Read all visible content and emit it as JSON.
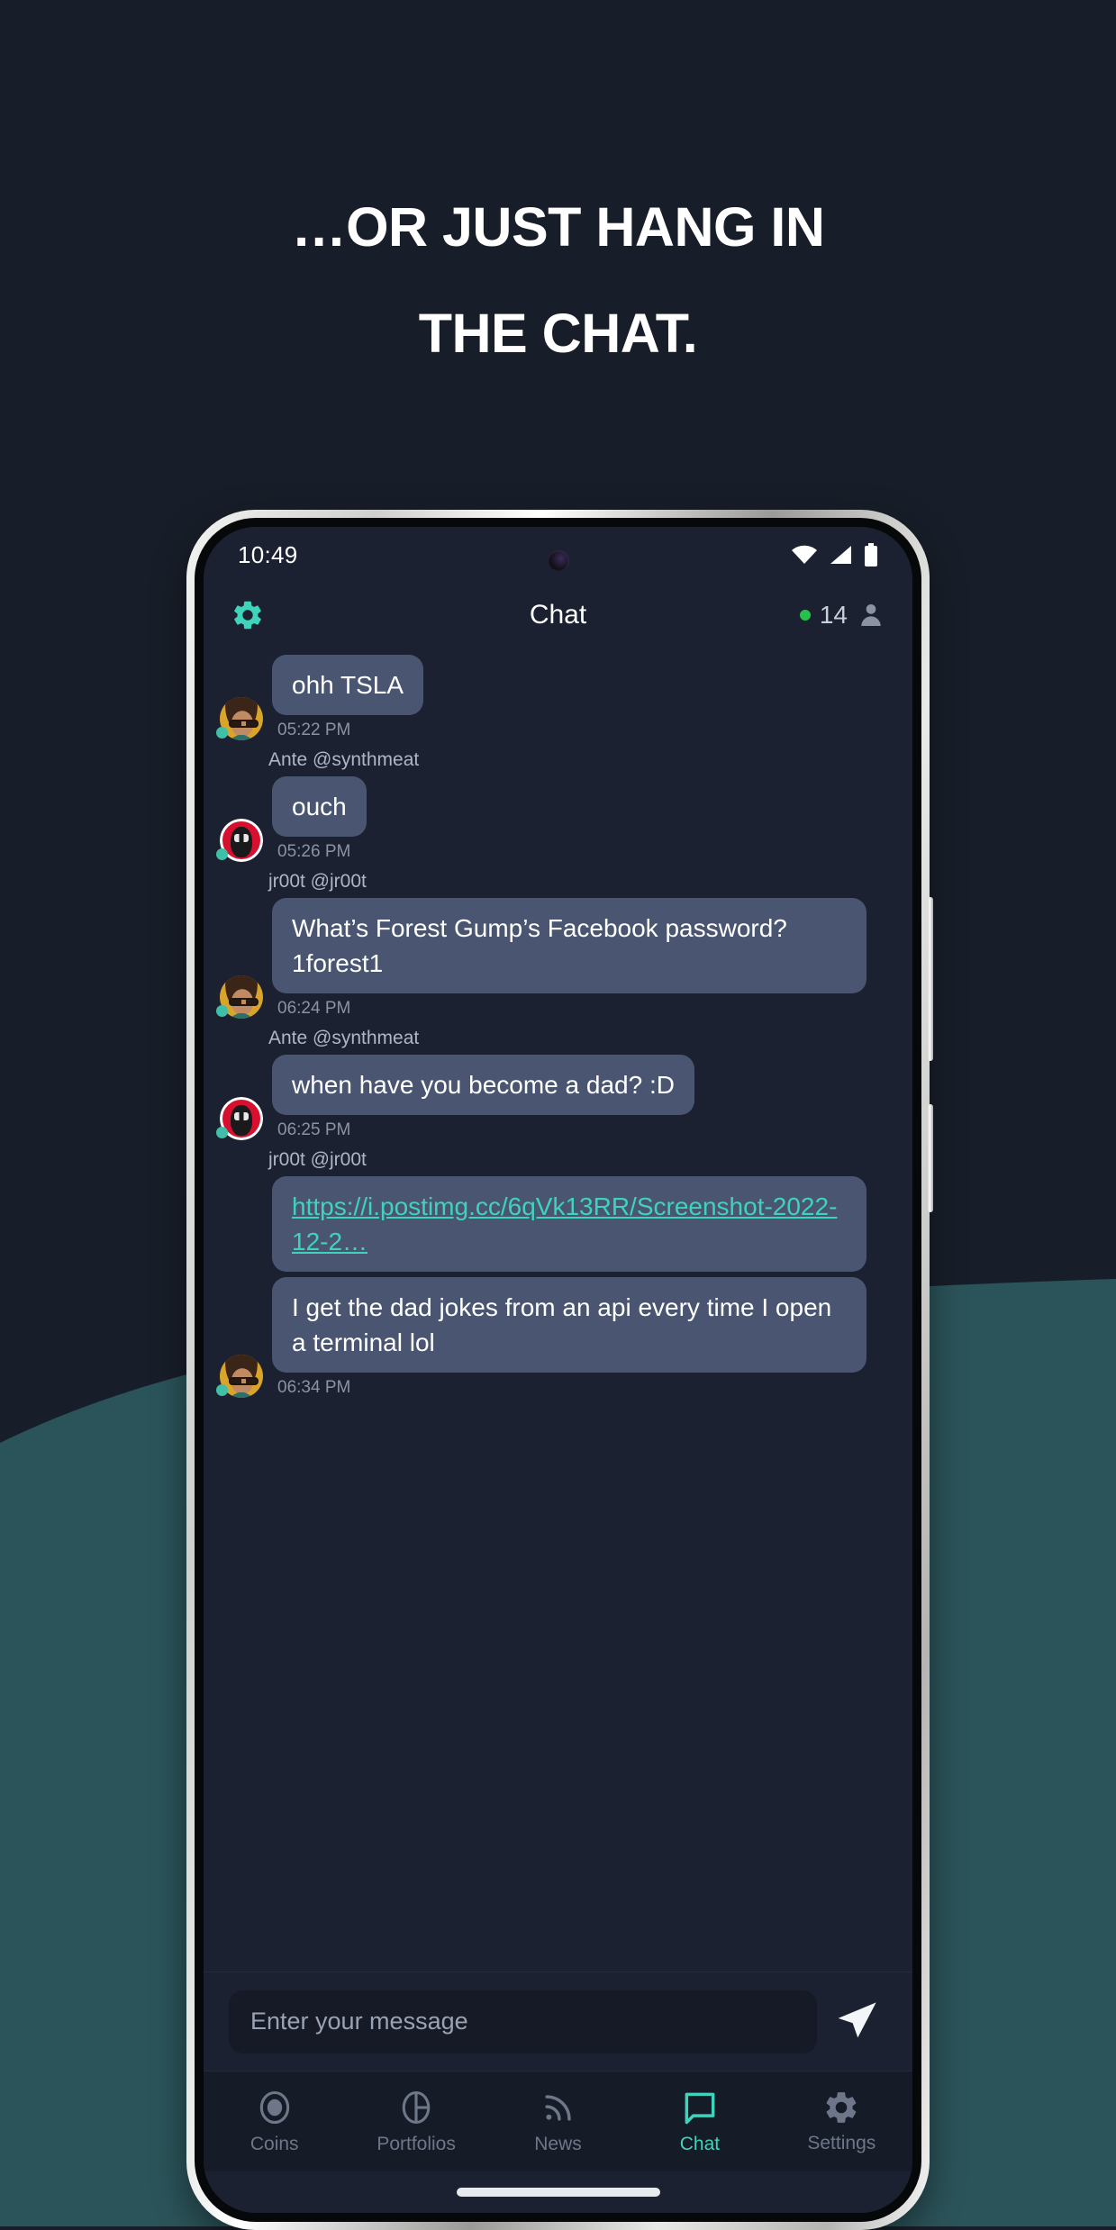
{
  "promo": {
    "headline_line1": "…OR JUST HANG IN",
    "headline_line2": "THE CHAT.",
    "bg_color": "#181e29",
    "wave_color": "#2b545a"
  },
  "phone": {
    "status_bar": {
      "time": "10:49",
      "icons": [
        "wifi-icon",
        "cellular-signal-icon",
        "battery-icon"
      ]
    },
    "home_indicator": "home-indicator-bar"
  },
  "app": {
    "accent_color": "#3fd3bb",
    "header": {
      "settings_icon": "gear-icon",
      "title": "Chat",
      "online_dot_color": "#27c24c",
      "online_count": "14",
      "people_icon": "person-icon"
    },
    "messages": [
      {
        "avatar": "face-a",
        "text": "ohh TSLA",
        "time": "05:22 PM",
        "type": "text",
        "sender_after": "Ante @synthmeat"
      },
      {
        "avatar": "face-b",
        "text": "ouch",
        "time": "05:26 PM",
        "type": "text",
        "sender_after": "jr00t @jr00t"
      },
      {
        "avatar": "face-a",
        "text": "What’s Forest Gump’s Facebook password? 1forest1",
        "time": "06:24 PM",
        "type": "text",
        "sender_after": "Ante @synthmeat"
      },
      {
        "avatar": "face-b",
        "text": "when have you become a dad? :D",
        "time": "06:25 PM",
        "type": "text",
        "sender_after": "jr00t @jr00t"
      },
      {
        "avatar": "",
        "text": "https://i.postimg.cc/6qVk13RR/Screenshot-2022-12-2…",
        "time": "",
        "type": "link",
        "sender_after": ""
      },
      {
        "avatar": "face-a",
        "text": "I get the dad jokes from an api every time I open a terminal lol",
        "time": "06:34 PM",
        "type": "text",
        "sender_after": ""
      }
    ],
    "composer": {
      "placeholder": "Enter your message",
      "send_icon": "send-paper-plane-icon"
    },
    "bottom_nav": {
      "active_index": 3,
      "items": [
        {
          "label": "Coins",
          "icon": "coins-target-icon"
        },
        {
          "label": "Portfolios",
          "icon": "portfolio-pie-icon"
        },
        {
          "label": "News",
          "icon": "rss-news-icon"
        },
        {
          "label": "Chat",
          "icon": "chat-bubble-icon"
        },
        {
          "label": "Settings",
          "icon": "settings-gear-icon"
        }
      ]
    }
  }
}
